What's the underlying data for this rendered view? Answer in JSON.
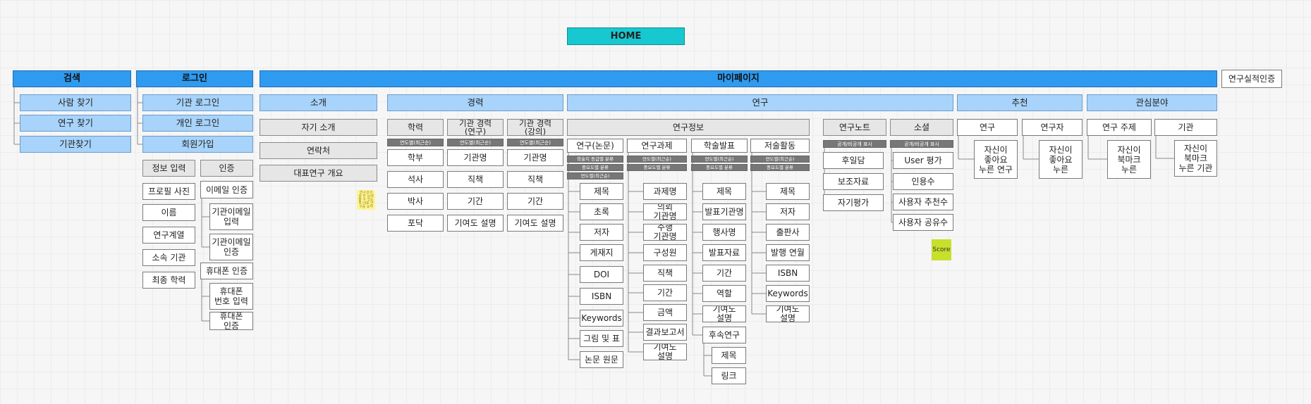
{
  "home": "HOME",
  "search": {
    "title": "검색",
    "items": [
      "사람 찾기",
      "연구 찾기",
      "기관찾기"
    ]
  },
  "login": {
    "title": "로그인",
    "items": [
      "기관 로그인",
      "개인 로그인",
      "회원가입"
    ],
    "signup": {
      "info": {
        "title": "정보 입력",
        "items": [
          "프로필 사진",
          "이름",
          "연구계열",
          "소속 기관",
          "최종 학력"
        ]
      },
      "auth": {
        "title": "인증",
        "email": "이메일 인증",
        "email_items": [
          "기관이메일 입력",
          "기관이메일 인증"
        ],
        "phone": "휴대폰 인증",
        "phone_items": [
          "휴대폰 번호 입력",
          "휴대폰 인증"
        ]
      }
    }
  },
  "mypage": {
    "title": "마이페이지",
    "cert": "연구실적인증",
    "intro": {
      "title": "소개",
      "items": [
        "자기 소개",
        "연락처",
        "대표연구 개요"
      ],
      "sticky_note": "연구성과를 한 눈에 볼 수 있도록 대표 연구를 요약"
    },
    "career": {
      "title": "경력",
      "columns": [
        {
          "title": "학력",
          "tag": "연도별(최근순)",
          "items": [
            "학부",
            "석사",
            "박사",
            "포닥"
          ]
        },
        {
          "title": "기관 경력(연구)",
          "tag": "연도별(최근순)",
          "items": [
            "기관명",
            "직책",
            "기간",
            "기여도 설명"
          ]
        },
        {
          "title": "기관 경력(강의)",
          "tag": "연도별(최근순)",
          "items": [
            "기관명",
            "직책",
            "기간",
            "기여도 설명"
          ]
        }
      ]
    },
    "research": {
      "title": "연구",
      "info": {
        "title": "연구정보",
        "columns": [
          {
            "title": "연구(논문)",
            "tags": [
              "학술지 등급별 분류",
              "중요도별 분류",
              "연도별(최근순)"
            ],
            "items": [
              "제목",
              "초록",
              "저자",
              "게재지",
              "DOI",
              "ISBN",
              "Keywords",
              "그림 및 표",
              "논문 원문"
            ]
          },
          {
            "title": "연구과제",
            "tags": [
              "연도별(최근순)",
              "중요도별 분류"
            ],
            "items": [
              "과제명",
              "의뢰 기관명",
              "수행 기관명",
              "구성원",
              "직책",
              "기간",
              "금액",
              "결과보고서",
              "기여도 설명"
            ]
          },
          {
            "title": "학술발표",
            "tags": [
              "연도별(최근순)",
              "중요도별 분류"
            ],
            "items": [
              "제목",
              "발표기관명",
              "행사명",
              "발표자료",
              "기간",
              "역할",
              "기여도 설명"
            ],
            "sub_parent": "후속연구",
            "sub_items": [
              "제목",
              "링크"
            ]
          },
          {
            "title": "저술활동",
            "tags": [
              "연도별(최근순)",
              "중요도별 분류"
            ],
            "items": [
              "제목",
              "저자",
              "출판사",
              "발행 연월",
              "ISBN",
              "Keywords",
              "기여도 설명"
            ]
          }
        ]
      },
      "notes": {
        "title": "연구노트",
        "tag": "공개/비공개 표시",
        "items": [
          "후일담",
          "보조자료",
          "자기평가"
        ]
      },
      "social": {
        "title": "소셜",
        "tag": "공개/비공개 표시",
        "items": [
          "User 평가",
          "인용수",
          "사용자 추천수",
          "사용자 공유수"
        ],
        "sticky_note": "Score"
      }
    },
    "recommend": {
      "title": "추천",
      "columns": [
        {
          "title": "연구",
          "child": "자신이 좋아요 누른 연구"
        },
        {
          "title": "연구자",
          "child": "자신이 좋아요 누른"
        }
      ]
    },
    "interest": {
      "title": "관심분야",
      "columns": [
        {
          "title": "연구 주제",
          "child": "자신이 북마크 누른"
        },
        {
          "title": "기관",
          "child": "자신이 북마크 누른 기관"
        }
      ]
    }
  },
  "colors": {
    "home": "#17c8d0",
    "header_blue": "#2e9bf0",
    "light_blue": "#a8d3fa",
    "gray_box": "#e6e6e6",
    "tag_dark": "#777777",
    "sticky_yellow": "#fbf59b",
    "sticky_green": "#c8e02c"
  }
}
